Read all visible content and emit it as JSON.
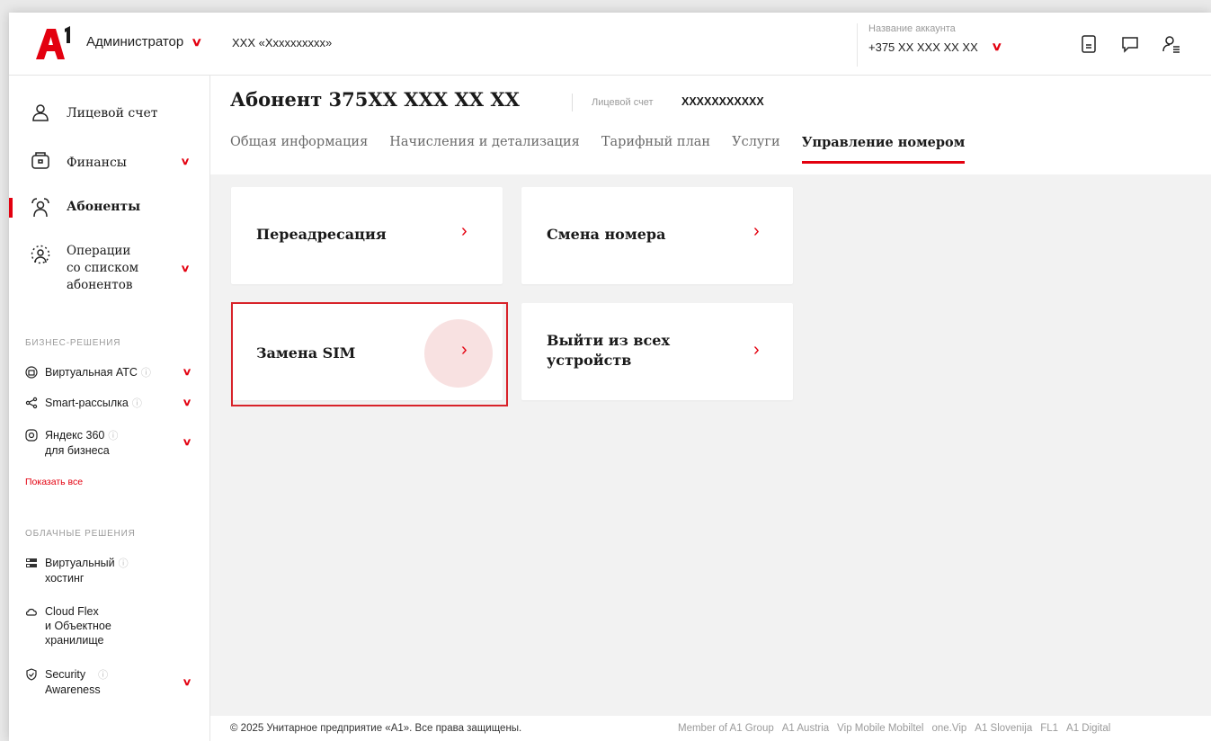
{
  "header": {
    "role": "Администратор",
    "company": "ХХХ «Хххххххххх»",
    "account_label": "Название аккаунта",
    "account_number": "+375 XX XXX XX XX"
  },
  "sidebar": {
    "items": [
      {
        "label": "Лицевой счет",
        "icon": "user-icon"
      },
      {
        "label": "Финансы",
        "icon": "wallet-icon"
      },
      {
        "label": "Абоненты",
        "icon": "users-icon",
        "active": true
      },
      {
        "label_lines": [
          "Операции",
          "со списком",
          "абонентов"
        ],
        "icon": "users-ops-icon"
      }
    ],
    "business": {
      "title": "БИЗНЕС-РЕШЕНИЯ",
      "items": [
        {
          "label": "Виртуальная АТС",
          "icon": "pbx-icon"
        },
        {
          "label": "Smart-рассылка",
          "icon": "share-icon"
        },
        {
          "label_lines": [
            "Яндекс 360",
            "для бизнеса"
          ],
          "icon": "yandex360-icon"
        }
      ],
      "show_all": "Показать все"
    },
    "cloud": {
      "title": "ОБЛАЧНЫЕ РЕШЕНИЯ",
      "items": [
        {
          "label_lines": [
            "Виртуальный",
            "хостинг"
          ],
          "icon": "server-icon"
        },
        {
          "label_lines": [
            "Cloud Flex",
            "и Объектное",
            "хранилище"
          ],
          "icon": "cloud-icon"
        },
        {
          "label_lines": [
            "Security",
            "Awareness"
          ],
          "icon": "shield-icon"
        }
      ]
    }
  },
  "main": {
    "title": "Абонент 375XX XXX XX XX",
    "account_label": "Лицевой счет",
    "account_value": "XXXXXXXXXXX",
    "tabs": [
      {
        "label": "Общая информация"
      },
      {
        "label": "Начисления и детализация"
      },
      {
        "label": "Тарифный план"
      },
      {
        "label": "Услуги"
      },
      {
        "label": "Управление номером",
        "active": true
      }
    ],
    "cards": [
      {
        "label": "Переадресация"
      },
      {
        "label": "Смена номера"
      },
      {
        "label": "Замена SIM"
      },
      {
        "label_lines": [
          "Выйти из всех",
          "устройств"
        ]
      }
    ]
  },
  "footer": {
    "copyright": "© 2025 Унитарное предприятие «А1». Все права защищены.",
    "links": [
      "Member of A1 Group",
      "A1 Austria",
      "Vip Mobile Mobiltel",
      "one.Vip",
      "A1 Slovenija",
      "FL1",
      "A1 Digital"
    ]
  },
  "colors": {
    "accent": "#e3000f",
    "highlight_border": "#d8232a"
  }
}
